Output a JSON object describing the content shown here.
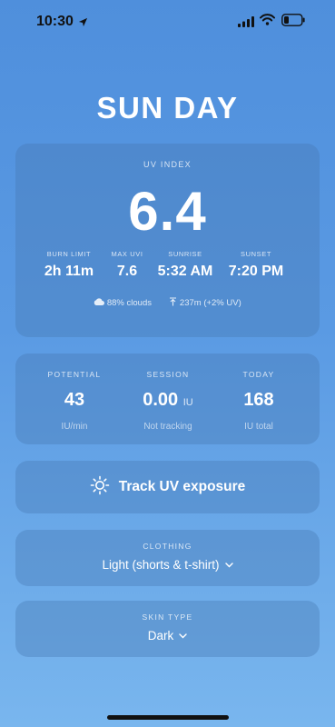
{
  "status_bar": {
    "time": "10:30"
  },
  "app": {
    "title": "SUN DAY"
  },
  "uv_card": {
    "label": "UV INDEX",
    "value": "6.4",
    "stats": [
      {
        "label": "BURN LIMIT",
        "value": "2h 11m"
      },
      {
        "label": "MAX UVI",
        "value": "7.6"
      },
      {
        "label": "SUNRISE",
        "value": "5:32 AM"
      },
      {
        "label": "SUNSET",
        "value": "7:20 PM"
      }
    ],
    "clouds": "88% clouds",
    "altitude": "237m",
    "altitude_uv": "(+2% UV)"
  },
  "tracking": {
    "potential": {
      "label": "POTENTIAL",
      "value": "43",
      "sub": "IU/min"
    },
    "session": {
      "label": "SESSION",
      "value": "0.00",
      "unit": "IU",
      "sub": "Not tracking"
    },
    "today": {
      "label": "TODAY",
      "value": "168",
      "sub": "IU total"
    }
  },
  "track_button": {
    "label": "Track UV exposure"
  },
  "clothing": {
    "label": "CLOTHING",
    "value": "Light (shorts & t-shirt)"
  },
  "skin_type": {
    "label": "SKIN TYPE",
    "value": "Dark"
  },
  "icons": [
    "location-arrow-icon",
    "signal-icon",
    "wifi-icon",
    "battery-icon",
    "cloud-icon",
    "altitude-arrow-icon",
    "sun-icon",
    "chevron-down-icon"
  ]
}
